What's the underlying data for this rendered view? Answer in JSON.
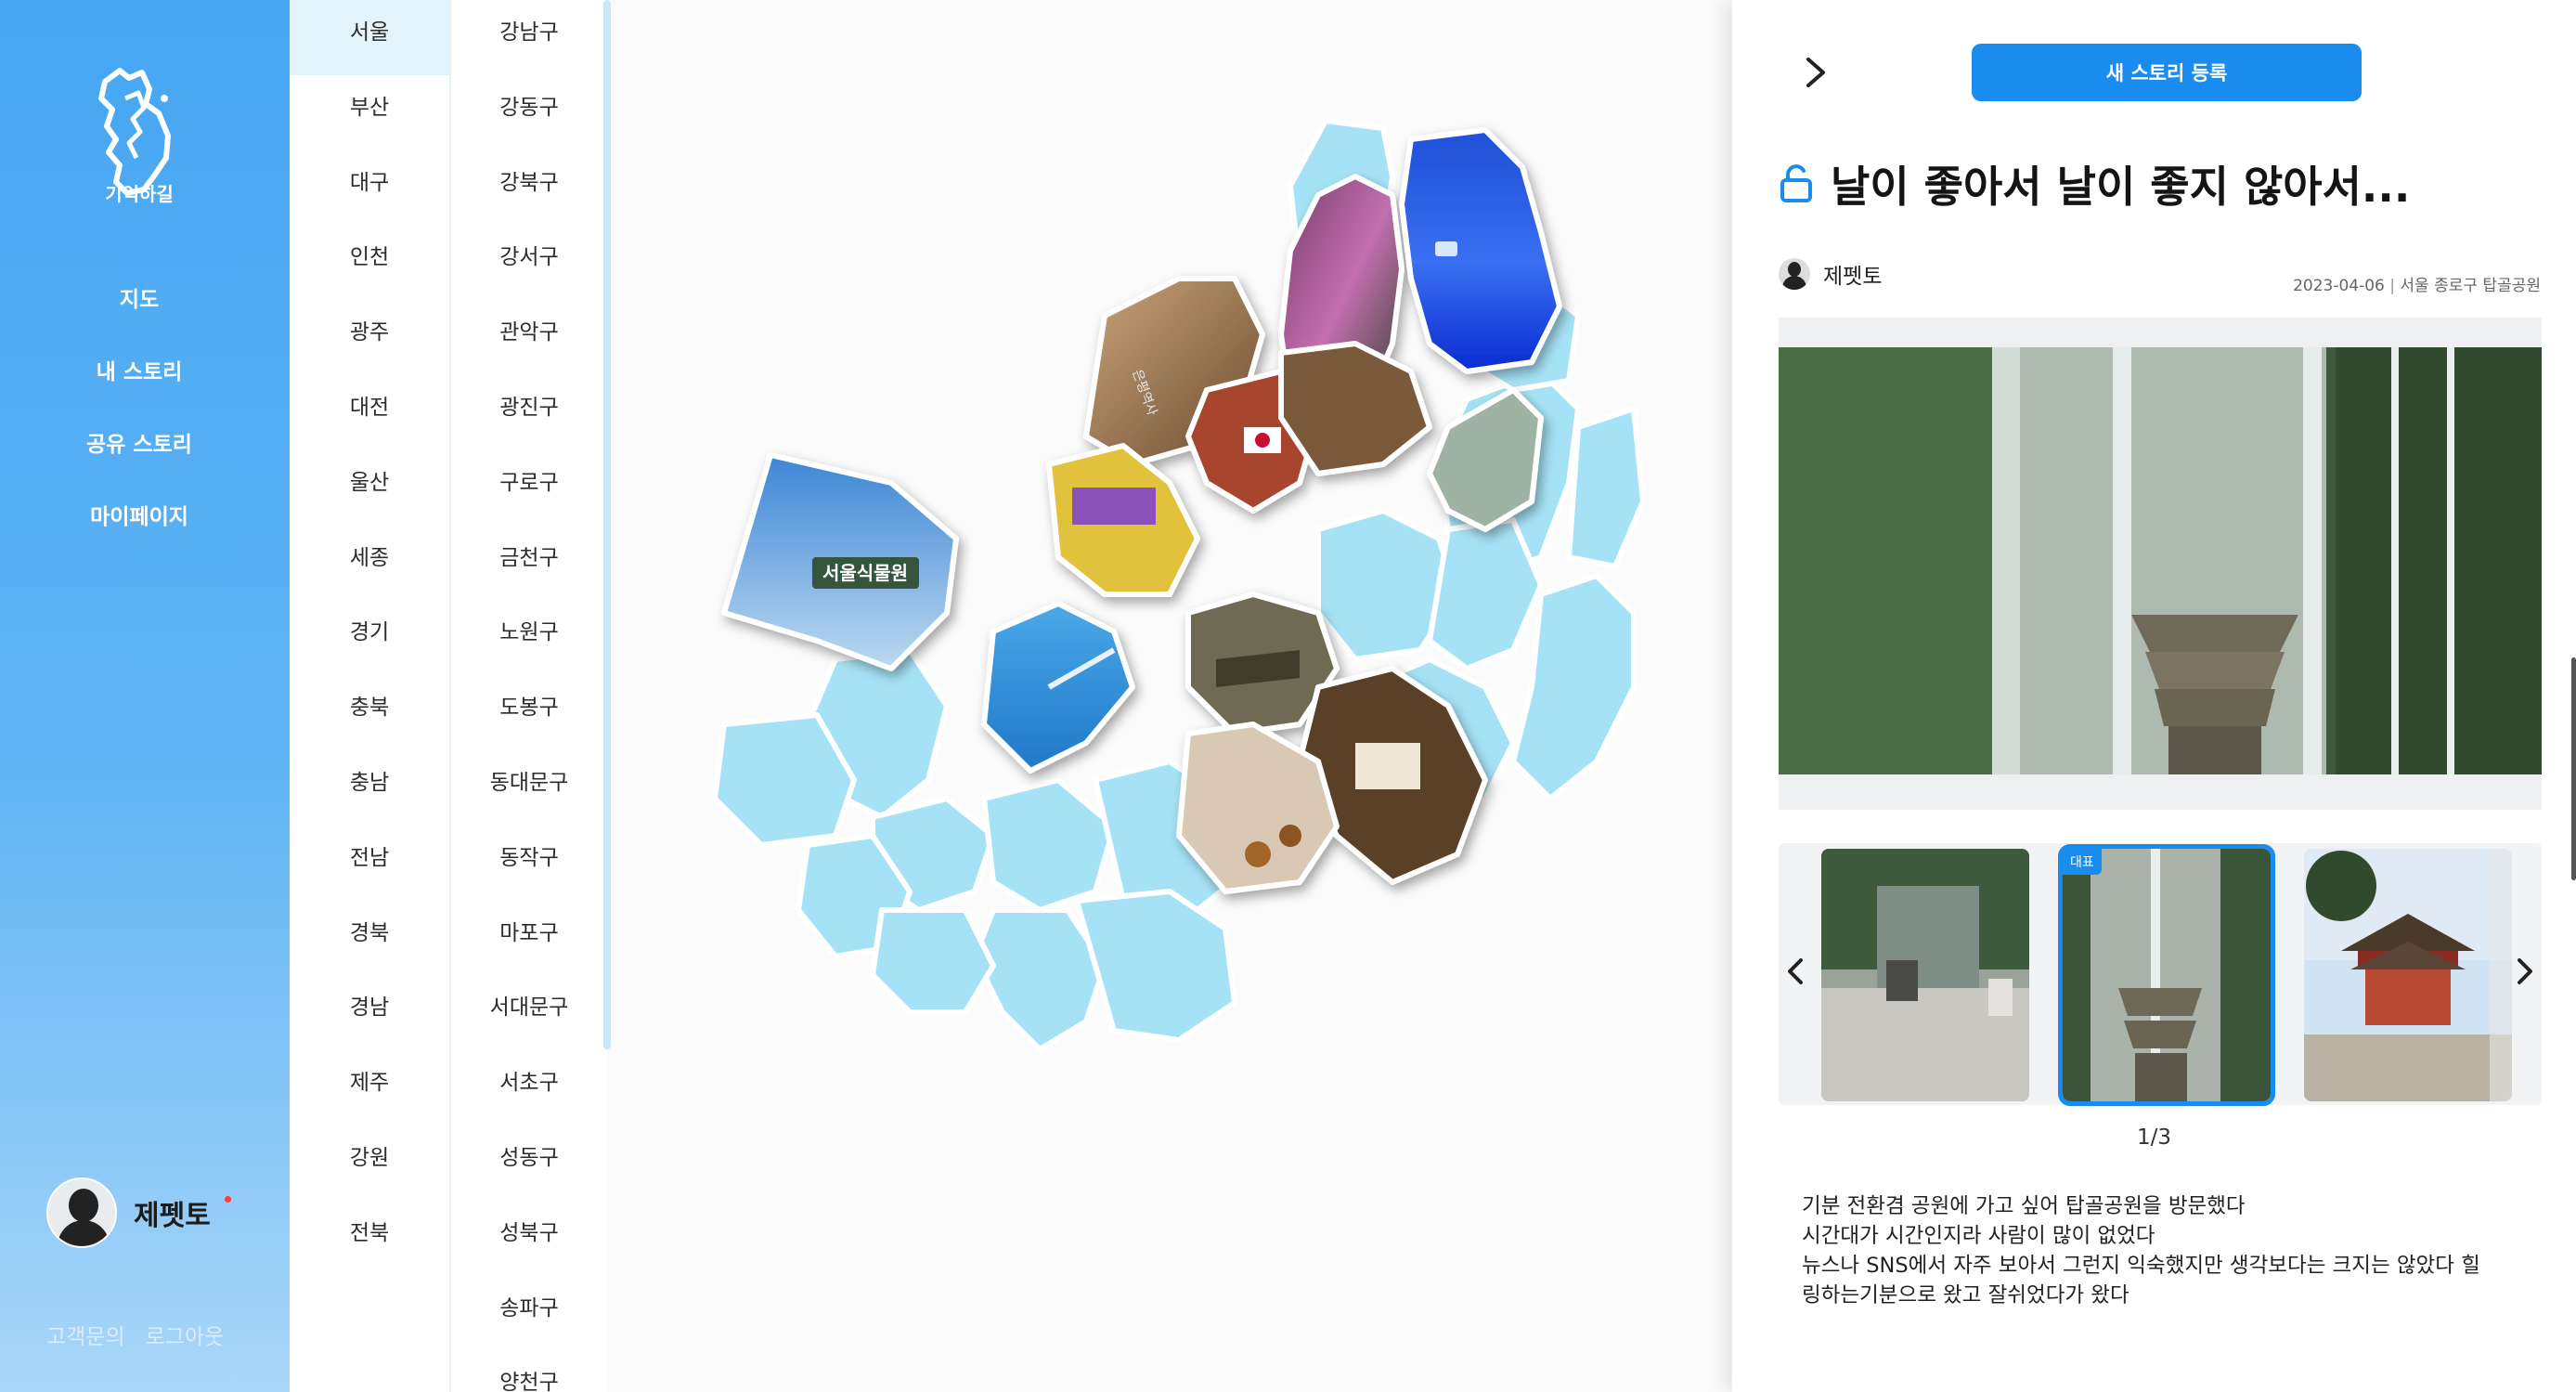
{
  "app": {
    "logo_text": "기억하길"
  },
  "nav": [
    {
      "label": "지도"
    },
    {
      "label": "내 스토리"
    },
    {
      "label": "공유 스토리"
    },
    {
      "label": "마이페이지"
    }
  ],
  "profile": {
    "name": "제펫토"
  },
  "footer": {
    "support": "고객문의",
    "logout": "로그아웃"
  },
  "regions": [
    {
      "label": "서울",
      "active": true
    },
    {
      "label": "부산"
    },
    {
      "label": "대구"
    },
    {
      "label": "인천"
    },
    {
      "label": "광주"
    },
    {
      "label": "대전"
    },
    {
      "label": "울산"
    },
    {
      "label": "세종"
    },
    {
      "label": "경기"
    },
    {
      "label": "충북"
    },
    {
      "label": "충남"
    },
    {
      "label": "전남"
    },
    {
      "label": "경북"
    },
    {
      "label": "경남"
    },
    {
      "label": "제주"
    },
    {
      "label": "강원"
    },
    {
      "label": "전북"
    }
  ],
  "districts": [
    {
      "label": "강남구"
    },
    {
      "label": "강동구"
    },
    {
      "label": "강북구"
    },
    {
      "label": "강서구"
    },
    {
      "label": "관악구"
    },
    {
      "label": "광진구"
    },
    {
      "label": "구로구"
    },
    {
      "label": "금천구"
    },
    {
      "label": "노원구"
    },
    {
      "label": "도봉구"
    },
    {
      "label": "동대문구"
    },
    {
      "label": "동작구"
    },
    {
      "label": "마포구"
    },
    {
      "label": "서대문구"
    },
    {
      "label": "서초구"
    },
    {
      "label": "성동구"
    },
    {
      "label": "성북구"
    },
    {
      "label": "송파구"
    },
    {
      "label": "양천구"
    }
  ],
  "map": {
    "region_color": "#a6e2f5",
    "photo_sign_text": "서울식물원",
    "photo_station_text": "은평역사"
  },
  "panel": {
    "new_story_label": "새 스토리 등록",
    "title": "날이 좋아서 날이 좋지 않아서...",
    "author": "제펫토",
    "date": "2023-04-06",
    "location": "서울 종로구 탑골공원",
    "badge_label": "대표",
    "pager": "1/3",
    "body_lines": [
      "기분 전환겸 공원에 가고 싶어 탑골공원을 방문했다",
      "시간대가 시간인지라 사람이 많이 없었다",
      "뉴스나 SNS에서 자주 보아서 그런지 익숙했지만 생각보다는 크지는 않았다 힐",
      "링하는기분으로 왔고 잘쉬었다가 왔다"
    ]
  },
  "colors": {
    "accent": "#1a8cf0",
    "sidebar": "#46a6f2"
  }
}
